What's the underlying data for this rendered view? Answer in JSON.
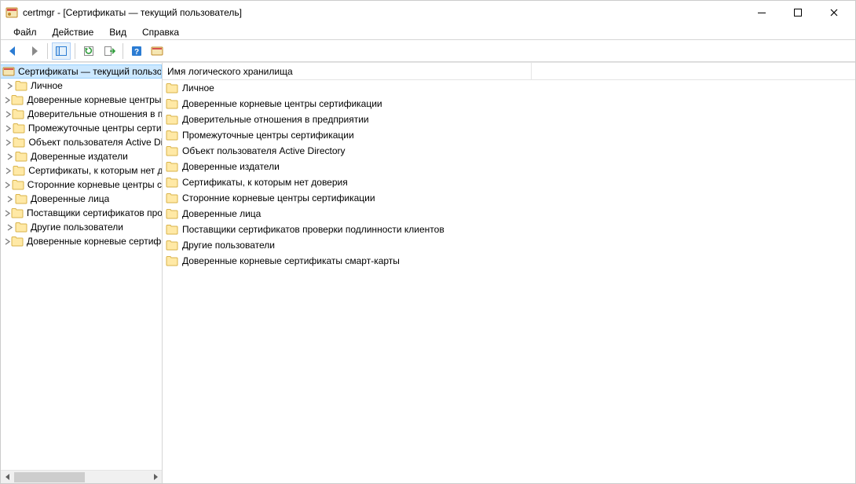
{
  "titlebar": {
    "title": "certmgr - [Сертификаты — текущий пользователь]"
  },
  "menubar": {
    "file": "Файл",
    "action": "Действие",
    "view": "Вид",
    "help": "Справка"
  },
  "tree": {
    "root_label": "Сертификаты — текущий пользователь",
    "items": [
      {
        "label": "Личное"
      },
      {
        "label": "Доверенные корневые центры сертификации"
      },
      {
        "label": "Доверительные отношения в предприятии"
      },
      {
        "label": "Промежуточные центры сертификации"
      },
      {
        "label": "Объект пользователя Active Directory"
      },
      {
        "label": "Доверенные издатели"
      },
      {
        "label": "Сертификаты, к которым нет доверия"
      },
      {
        "label": "Сторонние корневые центры сертификации"
      },
      {
        "label": "Доверенные лица"
      },
      {
        "label": "Поставщики сертификатов проверки подлинности клиентов"
      },
      {
        "label": "Другие пользователи"
      },
      {
        "label": "Доверенные корневые сертификаты смарт-карты"
      }
    ]
  },
  "list": {
    "column_header": "Имя логического хранилища",
    "items": [
      {
        "label": "Личное"
      },
      {
        "label": "Доверенные корневые центры сертификации"
      },
      {
        "label": "Доверительные отношения в предприятии"
      },
      {
        "label": "Промежуточные центры сертификации"
      },
      {
        "label": "Объект пользователя Active Directory"
      },
      {
        "label": "Доверенные издатели"
      },
      {
        "label": "Сертификаты, к которым нет доверия"
      },
      {
        "label": "Сторонние корневые центры сертификации"
      },
      {
        "label": "Доверенные лица"
      },
      {
        "label": "Поставщики сертификатов проверки подлинности клиентов"
      },
      {
        "label": "Другие пользователи"
      },
      {
        "label": "Доверенные корневые сертификаты смарт-карты"
      }
    ]
  }
}
